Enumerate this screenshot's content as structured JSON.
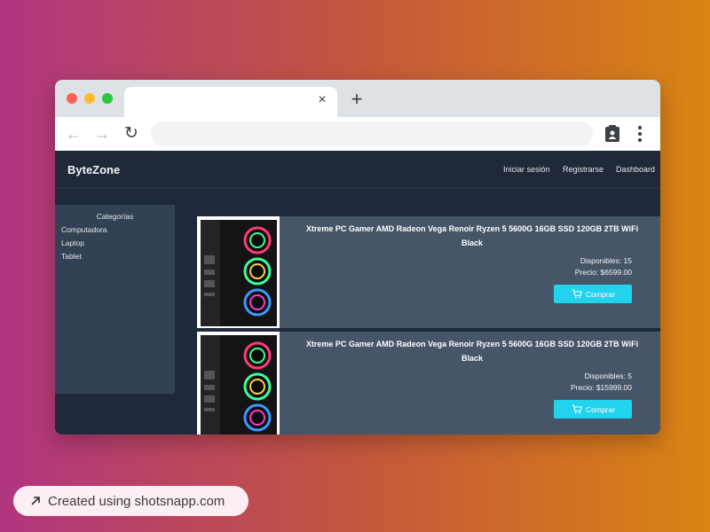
{
  "browser": {
    "tab_close": "×",
    "new_tab": "+",
    "back": "←",
    "forward": "→",
    "reload": "↻"
  },
  "navbar": {
    "brand": "ByteZone",
    "links": [
      "Iniciar sesión",
      "Registrarse",
      "Dashboard"
    ]
  },
  "sidebar": {
    "title": "Categorías",
    "categories": [
      "Computadora",
      "Laptop",
      "Tablet"
    ]
  },
  "products": [
    {
      "title": "Xtreme PC Gamer AMD Radeon Vega Renoir Ryzen 5 5600G 16GB SSD 120GB 2TB WiFi Black",
      "stock": "Disponibles: 15",
      "price": "Precio: $6599.00",
      "button": "Comprar"
    },
    {
      "title": "Xtreme PC Gamer AMD Radeon Vega Renoir Ryzen 5 5600G 16GB SSD 120GB 2TB WiFi Black",
      "stock": "Disponibles: 5",
      "price": "Precio: $15999.00",
      "button": "Comprar"
    }
  ],
  "badge": {
    "text": "Created using shotsnapp.com"
  },
  "colors": {
    "accent": "#22d3ee",
    "card": "#475569",
    "sidebar": "#334155",
    "navbar": "#1f2937"
  }
}
